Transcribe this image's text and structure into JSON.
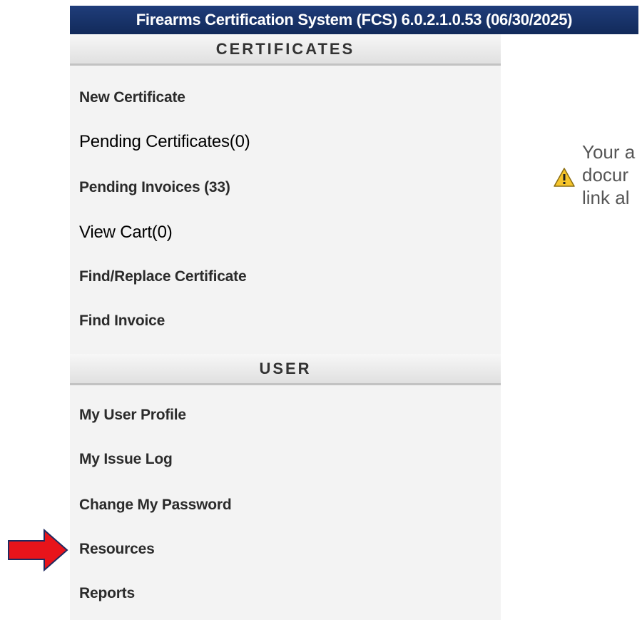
{
  "app": {
    "title": "Firearms Certification System (FCS) 6.0.2.1.0.53 (06/30/2025)"
  },
  "sidebar": {
    "certificates_header": "CERTIFICATES",
    "certificates_items": [
      {
        "label": "New Certificate"
      },
      {
        "label": "Pending Certificates(0)"
      },
      {
        "label": "Pending Invoices (33)"
      },
      {
        "label": "View Cart(0)"
      },
      {
        "label": "Find/Replace Certificate"
      },
      {
        "label": "Find Invoice"
      }
    ],
    "user_header": "USER",
    "user_items": [
      {
        "label": "My User Profile"
      },
      {
        "label": "My Issue Log"
      },
      {
        "label": "Change My Password"
      },
      {
        "label": "Resources"
      },
      {
        "label": "Reports"
      }
    ]
  },
  "notice": {
    "icon": "warning-icon",
    "lines": [
      "Your a",
      "docur",
      "link al"
    ]
  },
  "annotation": {
    "icon": "red-arrow-icon",
    "color": "#e8141b"
  }
}
